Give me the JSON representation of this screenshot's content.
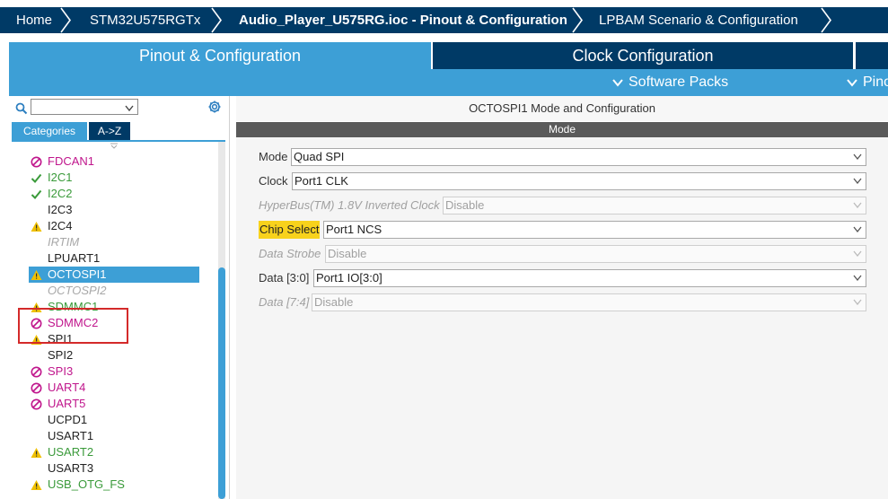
{
  "breadcrumb": {
    "home": "Home",
    "device": "STM32U575RGTx",
    "project": "Audio_Player_U575RG.ioc - Pinout & Configuration",
    "scenario": "LPBAM Scenario & Configuration"
  },
  "tabs": {
    "pinout": "Pinout & Configuration",
    "clock": "Clock Configuration"
  },
  "toolbar": {
    "software_packs": "Software Packs",
    "pinout": "Pino"
  },
  "left": {
    "search_value": "",
    "tab_categories": "Categories",
    "tab_az": "A->Z",
    "items": [
      {
        "label": "FDCAN1",
        "status": "disabled"
      },
      {
        "label": "I2C1",
        "status": "ok"
      },
      {
        "label": "I2C2",
        "status": "ok"
      },
      {
        "label": "I2C3",
        "status": "none"
      },
      {
        "label": "I2C4",
        "status": "warning"
      },
      {
        "label": "IRTIM",
        "status": "unavailable"
      },
      {
        "label": "LPUART1",
        "status": "none"
      },
      {
        "label": "OCTOSPI1",
        "status": "warning-selected"
      },
      {
        "label": "OCTOSPI2",
        "status": "unavailable"
      },
      {
        "label": "SDMMC1",
        "status": "warning"
      },
      {
        "label": "SDMMC2",
        "status": "disabled"
      },
      {
        "label": "SPI1",
        "status": "warning"
      },
      {
        "label": "SPI2",
        "status": "none"
      },
      {
        "label": "SPI3",
        "status": "disabled"
      },
      {
        "label": "UART4",
        "status": "disabled"
      },
      {
        "label": "UART5",
        "status": "disabled"
      },
      {
        "label": "UCPD1",
        "status": "none"
      },
      {
        "label": "USART1",
        "status": "none"
      },
      {
        "label": "USART2",
        "status": "warning"
      },
      {
        "label": "USART3",
        "status": "none"
      },
      {
        "label": "USB_OTG_FS",
        "status": "warning"
      }
    ]
  },
  "right": {
    "title": "OCTOSPI1 Mode and Configuration",
    "mode_header": "Mode",
    "fields": [
      {
        "label": "Mode",
        "value": "Quad SPI",
        "enabled": true
      },
      {
        "label": "Clock",
        "value": "Port1 CLK",
        "enabled": true
      },
      {
        "label": "HyperBus(TM) 1.8V Inverted Clock",
        "value": "Disable",
        "enabled": false
      },
      {
        "label": "Chip Select",
        "value": "Port1 NCS",
        "enabled": true,
        "highlighted": true
      },
      {
        "label": "Data Strobe",
        "value": "Disable",
        "enabled": false
      },
      {
        "label": "Data [3:0]",
        "value": "Port1 IO[3:0]",
        "enabled": true
      },
      {
        "label": "Data [7:4]",
        "value": "Disable",
        "enabled": false
      }
    ]
  },
  "colors": {
    "navy": "#003a66",
    "accent_blue": "#3d9fd6",
    "pink": "#c0168c",
    "green": "#3a9a3a",
    "warning_yellow": "#f0c000",
    "highlight_yellow": "#f8d21c"
  }
}
